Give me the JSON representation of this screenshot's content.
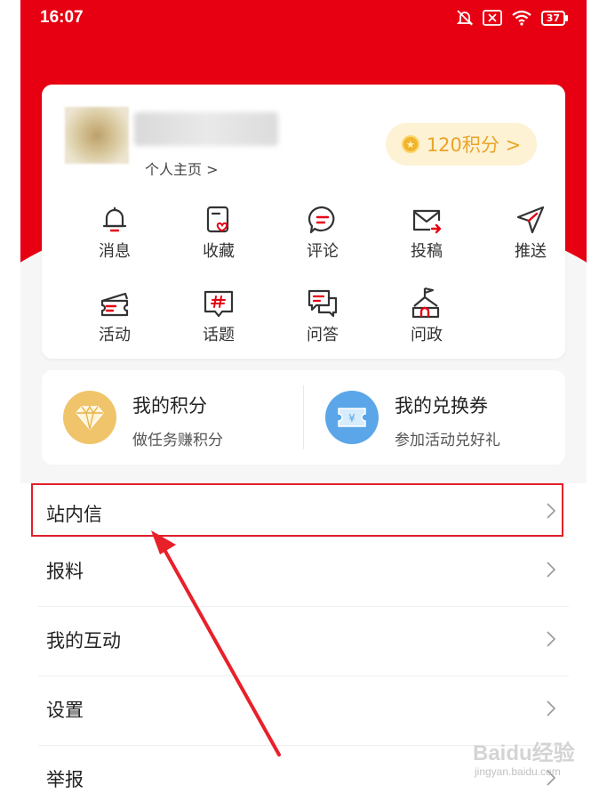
{
  "status_bar": {
    "time": "16:07",
    "battery": "37"
  },
  "profile": {
    "homepage_link": "个人主页 >",
    "points_label": "120积分 >"
  },
  "quick_actions": [
    {
      "label": "消息",
      "icon": "bell-icon"
    },
    {
      "label": "收藏",
      "icon": "favorite-icon"
    },
    {
      "label": "评论",
      "icon": "comment-icon"
    },
    {
      "label": "投稿",
      "icon": "submit-mail-icon"
    },
    {
      "label": "推送",
      "icon": "push-send-icon"
    },
    {
      "label": "活动",
      "icon": "ticket-icon"
    },
    {
      "label": "话题",
      "icon": "hashtag-icon"
    },
    {
      "label": "问答",
      "icon": "qa-icon"
    },
    {
      "label": "问政",
      "icon": "government-building-icon"
    }
  ],
  "rewards": {
    "points_title": "我的积分",
    "points_sub": "做任务赚积分",
    "coupon_title": "我的兑换券",
    "coupon_sub": "参加活动兑好礼"
  },
  "menu": [
    {
      "label": "站内信"
    },
    {
      "label": "报料"
    },
    {
      "label": "我的互动"
    },
    {
      "label": "设置"
    },
    {
      "label": "举报"
    }
  ],
  "watermark": {
    "brand": "Baidu经验",
    "url": "jingyan.baidu.com"
  },
  "colors": {
    "brand_red": "#e60012",
    "points_gold": "#e9a429",
    "coupon_blue": "#5aa6e8",
    "highlight_red": "#e21f2a"
  }
}
